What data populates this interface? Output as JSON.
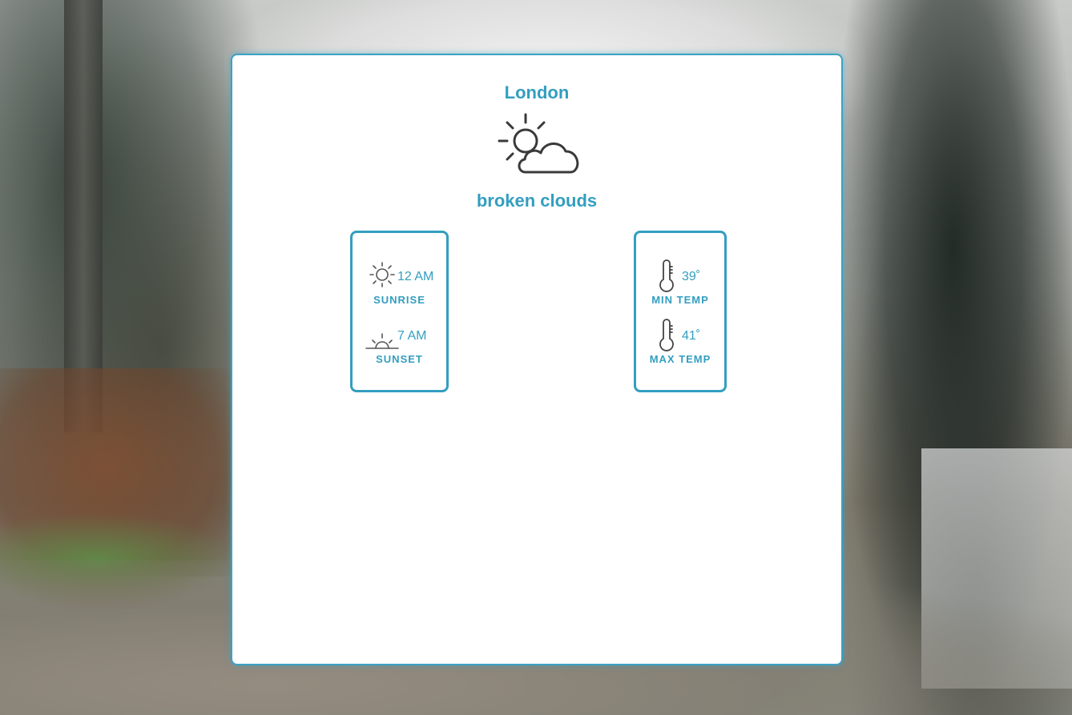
{
  "weather": {
    "city": "London",
    "condition": "broken clouds",
    "condition_icon": "sun-behind-cloud-icon",
    "accent_color": "#339ec0"
  },
  "sun_panel": {
    "sunrise": {
      "icon": "sunrise-icon",
      "value": "12 AM",
      "label": "SUNRISE"
    },
    "sunset": {
      "icon": "sunset-icon",
      "value": "7 AM",
      "label": "SUNSET"
    }
  },
  "temp_panel": {
    "min": {
      "icon": "thermometer-icon",
      "value": "39˚",
      "label": "MIN TEMP"
    },
    "max": {
      "icon": "thermometer-icon",
      "value": "41˚",
      "label": "MAX TEMP"
    }
  }
}
